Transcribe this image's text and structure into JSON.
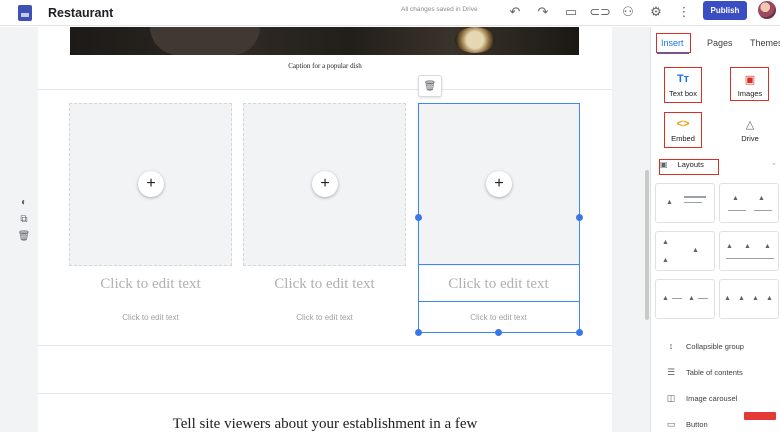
{
  "app": {
    "title": "Restaurant",
    "saved_status": "All changes saved in Drive",
    "publish_label": "Publish"
  },
  "toolbar_icons": [
    "undo-icon",
    "redo-icon",
    "preview-icon",
    "link-icon",
    "add-person-icon",
    "settings-icon",
    "more-vert-icon"
  ],
  "left_tools": [
    "theme-palette-icon",
    "duplicate-icon",
    "delete-icon"
  ],
  "canvas": {
    "caption": "Caption for a popular dish",
    "columns": [
      {
        "big_text": "Click to edit text",
        "small_text": "Click to edit text"
      },
      {
        "big_text": "Click to edit text",
        "small_text": "Click to edit text"
      },
      {
        "big_text": "Click to edit text",
        "small_text": "Click to edit text"
      }
    ],
    "bottom_text": "Tell site viewers about your establishment in a few"
  },
  "panel": {
    "tabs": [
      "Insert",
      "Pages",
      "Themes"
    ],
    "insert_items": [
      {
        "label": "Text box",
        "icon": "text-box-icon",
        "glyph": "Tт"
      },
      {
        "label": "Images",
        "icon": "images-icon",
        "glyph": "▣"
      },
      {
        "label": "Embed",
        "icon": "embed-icon",
        "glyph": "<>"
      },
      {
        "label": "Drive",
        "icon": "drive-icon",
        "glyph": "△"
      }
    ],
    "layouts_label": "Layouts",
    "components": [
      {
        "label": "Collapsible group",
        "glyph": "↕"
      },
      {
        "label": "Table of contents",
        "glyph": "☰"
      },
      {
        "label": "Image carousel",
        "glyph": "◫"
      },
      {
        "label": "Button",
        "glyph": "▭"
      }
    ]
  },
  "colors": {
    "accent": "#1a73e8",
    "publish": "#3a4ec4",
    "highlight": "#d93025",
    "selection": "#4285f4"
  }
}
